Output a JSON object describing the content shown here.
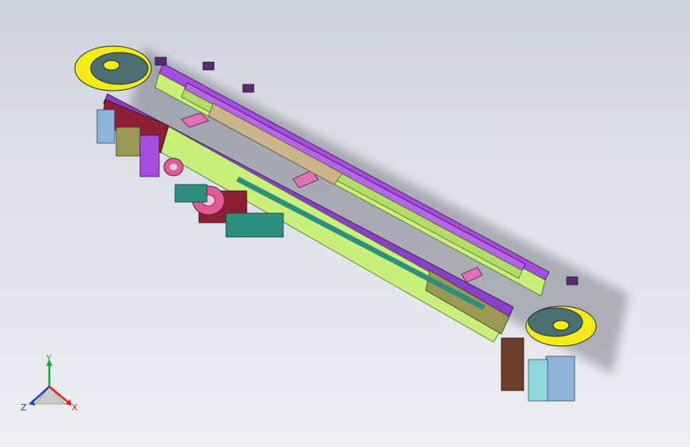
{
  "viewport": {
    "background_top": "#cfd3dc",
    "background_bottom": "#eceef2"
  },
  "model": {
    "description_colors": {
      "rail_green": "#c8f07a",
      "rail_purple": "#a64ce0",
      "end_plate_teal": "#4a6e72",
      "end_ring_yellow": "#f2ec1a",
      "motor_blue": "#8fb3d9",
      "bracket_brown": "#6b3f2b",
      "gear_pink": "#e05a93",
      "base_teal": "#2f8f7e"
    }
  },
  "triad": {
    "x_label": "X",
    "y_label": "Y",
    "z_label": "Z",
    "x_color": "#e0241c",
    "y_color": "#1aa83a",
    "z_color": "#1f3fb8"
  }
}
